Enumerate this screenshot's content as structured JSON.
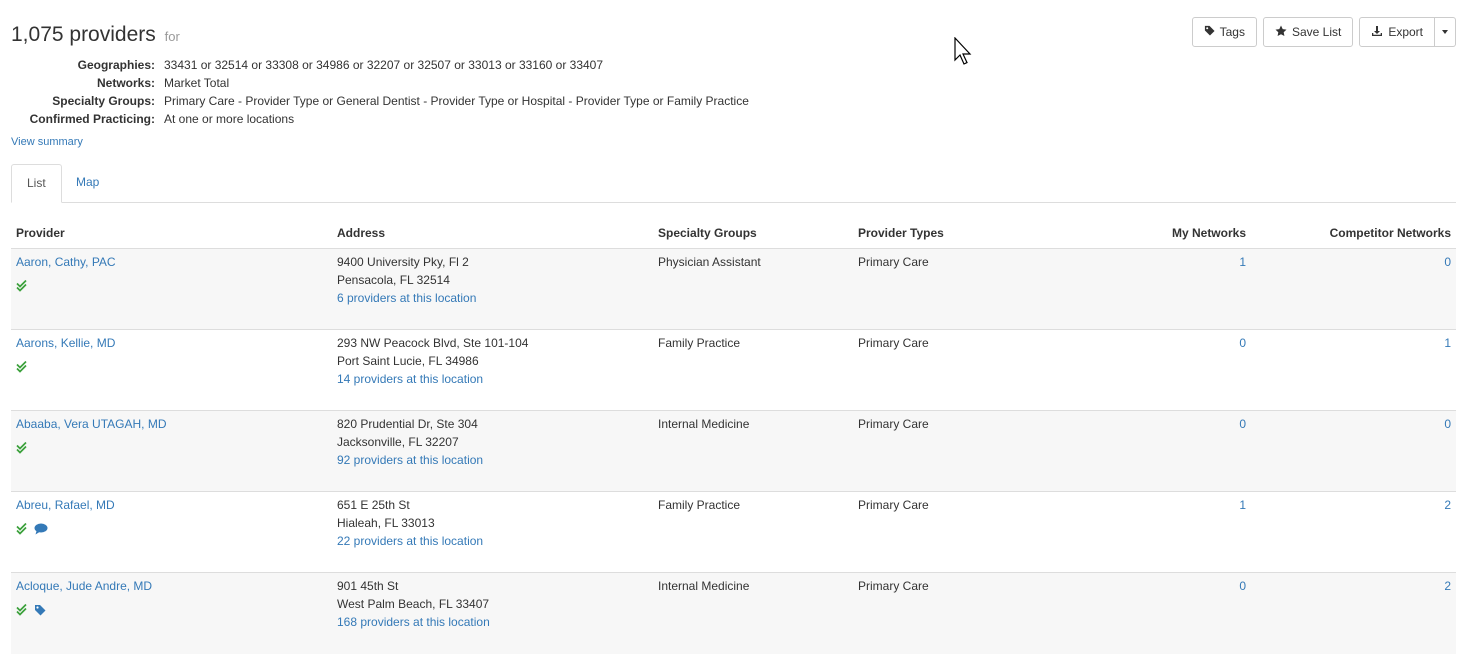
{
  "summary": {
    "count": "1,075 providers",
    "for_label": "for",
    "criteria": [
      {
        "key": "Geographies:",
        "value": "33431 or 32514 or 33308 or 34986 or 32207 or 32507 or 33013 or 33160 or 33407"
      },
      {
        "key": "Networks:",
        "value": "Market Total"
      },
      {
        "key": "Specialty Groups:",
        "value": "Primary Care - Provider Type or General Dentist - Provider Type or Hospital - Provider Type or Family Practice"
      },
      {
        "key": "Confirmed Practicing:",
        "value": "At one or more locations"
      }
    ],
    "view_summary": "View summary"
  },
  "toolbar": {
    "tags_label": "Tags",
    "tags_icon": "tag-icon",
    "save_label": "Save List",
    "save_icon": "star-icon",
    "export_label": "Export",
    "export_icon": "download-icon"
  },
  "tabs": [
    {
      "label": "List",
      "active": true
    },
    {
      "label": "Map",
      "active": false
    }
  ],
  "table": {
    "headers": [
      "Provider",
      "Address",
      "Specialty Groups",
      "Provider Types",
      "My Networks",
      "Competitor Networks"
    ],
    "rows": [
      {
        "provider": "Aaron, Cathy, PAC",
        "addr1": "9400 University Pky, Fl 2",
        "addr2": "Pensacola, FL 32514",
        "loc": "6 providers at this location",
        "specialty": "Physician Assistant",
        "type": "Primary Care",
        "my": "1",
        "comp": "0",
        "icons": [
          "double-check-icon"
        ]
      },
      {
        "provider": "Aarons, Kellie, MD",
        "addr1": "293 NW Peacock Blvd, Ste 101-104",
        "addr2": "Port Saint Lucie, FL 34986",
        "loc": "14 providers at this location",
        "specialty": "Family Practice",
        "type": "Primary Care",
        "my": "0",
        "comp": "1",
        "icons": [
          "double-check-icon"
        ]
      },
      {
        "provider": "Abaaba, Vera UTAGAH, MD",
        "addr1": "820 Prudential Dr, Ste 304",
        "addr2": "Jacksonville, FL 32207",
        "loc": "92 providers at this location",
        "specialty": "Internal Medicine",
        "type": "Primary Care",
        "my": "0",
        "comp": "0",
        "icons": [
          "double-check-icon"
        ]
      },
      {
        "provider": "Abreu, Rafael, MD",
        "addr1": "651 E 25th St",
        "addr2": "Hialeah, FL 33013",
        "loc": "22 providers at this location",
        "specialty": "Family Practice",
        "type": "Primary Care",
        "my": "1",
        "comp": "2",
        "icons": [
          "double-check-icon",
          "comment-icon"
        ]
      },
      {
        "provider": "Acloque, Jude Andre, MD",
        "addr1": "901 45th St",
        "addr2": "West Palm Beach, FL 33407",
        "loc": "168 providers at this location",
        "specialty": "Internal Medicine",
        "type": "Primary Care",
        "my": "0",
        "comp": "2",
        "icons": [
          "double-check-icon",
          "tag-icon"
        ]
      }
    ]
  },
  "colors": {
    "link": "#3479b7",
    "check": "#3aa03a",
    "border": "#dddddd",
    "row_alt": "#f7f7f7"
  }
}
